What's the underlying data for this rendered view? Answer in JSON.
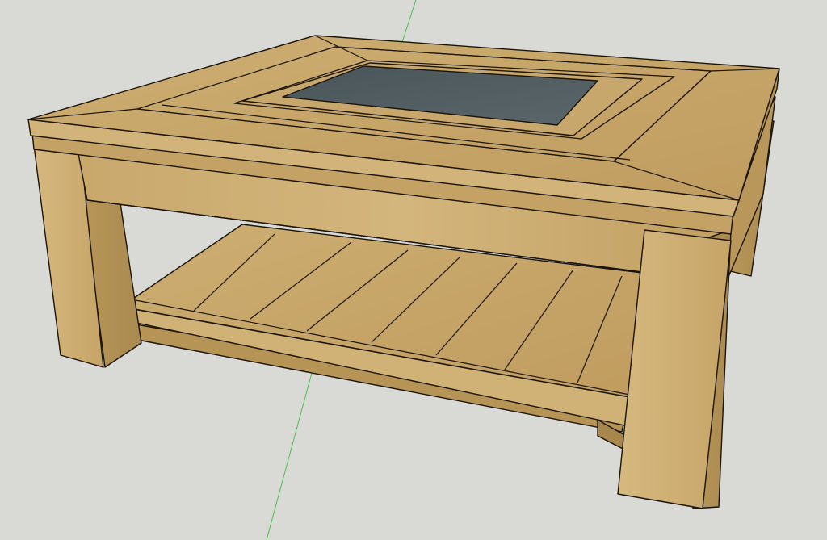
{
  "viewport": {
    "background_color": "#d9d9d6",
    "green_axis_color": "#4cbf4c"
  },
  "model": {
    "wood_color": "#c8a66a",
    "wood_shade_color": "#b39257",
    "wood_light_color": "#d4b679",
    "glass_color": "#4f5a5e",
    "edge_color": "#1a140c"
  }
}
